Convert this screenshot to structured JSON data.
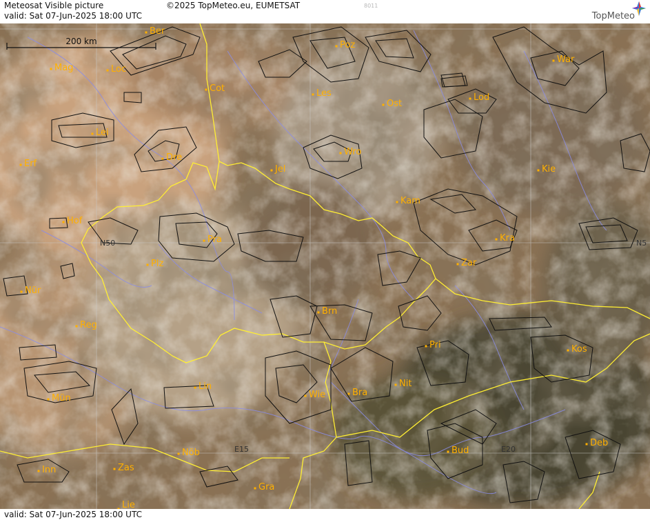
{
  "header": {
    "product": "Meteosat Visible picture",
    "valid": "valid:  Sat  07-Jun-2025  18:00 UTC",
    "copyright": "©2025 TopMeteo.eu, EUMETSAT",
    "code": "8011",
    "logo_text": "TopMeteo"
  },
  "footer": {
    "valid": "valid:  Sat  07-Jun-2025  18:00 UTC"
  },
  "scale_bar": {
    "label": "200 km"
  },
  "grid_labels": {
    "n50_left": "N50",
    "n50_right": "N5",
    "e15": "E15",
    "e20": "E20"
  },
  "cities": [
    "Ber",
    "Mag",
    "Loc",
    "Cot",
    "Poz",
    "War",
    "Les",
    "Lod",
    "Ost",
    "Lei",
    "Dre",
    "Wro",
    "Erf",
    "Jel",
    "Kie",
    "Kam",
    "Hof",
    "Pra",
    "Kra",
    "N50",
    "Plz",
    "Zar",
    "Nür",
    "Brn",
    "Reg",
    "Pri",
    "Kos",
    "Nit",
    "Lin",
    "Bra",
    "Wie",
    "Mün",
    "Nöb",
    "Zas",
    "Bud",
    "Deb",
    "Inn",
    "Gra",
    "Lie"
  ],
  "colors": {
    "city": "#ffb000",
    "border": "#ffee33",
    "river": "#8a8ce6",
    "grid": "#c8c8c8",
    "contour": "#111111"
  }
}
